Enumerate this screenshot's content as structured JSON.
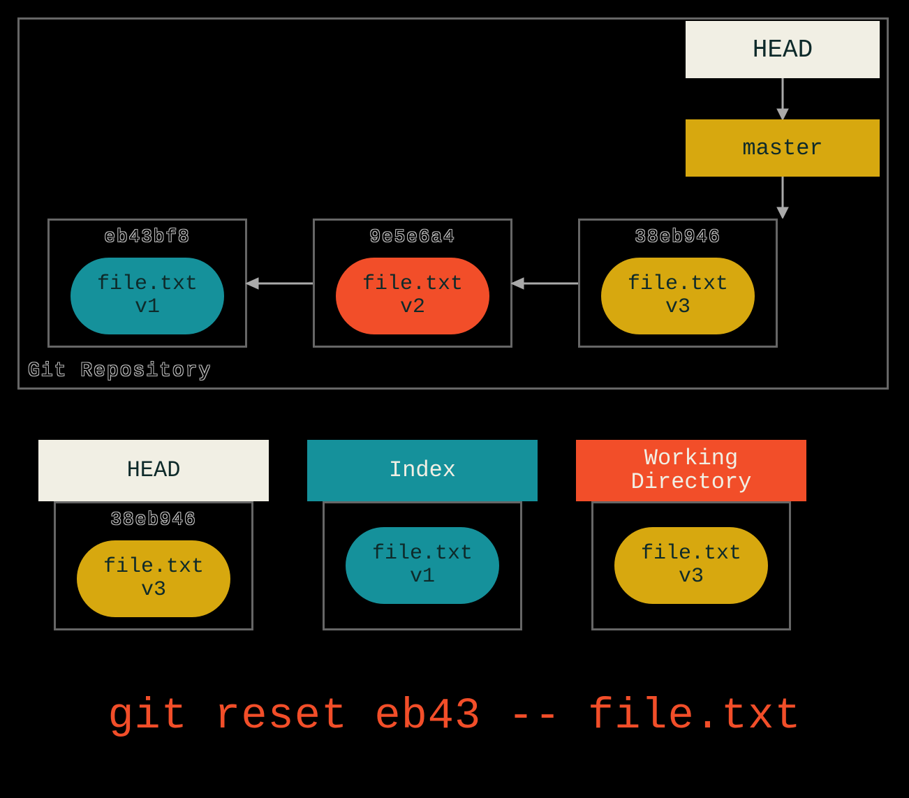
{
  "repo_label": "Git Repository",
  "head_top": "HEAD",
  "master": "master",
  "commits": [
    {
      "hash": "eb43bf8",
      "file": "file.txt",
      "ver": "v1",
      "color": "teal"
    },
    {
      "hash": "9e5e6a4",
      "file": "file.txt",
      "ver": "v2",
      "color": "orange"
    },
    {
      "hash": "38eb946",
      "file": "file.txt",
      "ver": "v3",
      "color": "gold"
    }
  ],
  "trees": {
    "head": {
      "label": "HEAD",
      "hash": "38eb946",
      "file": "file.txt",
      "ver": "v3",
      "pill_color": "gold"
    },
    "index": {
      "label": "Index",
      "file": "file.txt",
      "ver": "v1",
      "pill_color": "teal"
    },
    "work": {
      "label": "Working\nDirectory",
      "file": "file.txt",
      "ver": "v3",
      "pill_color": "gold"
    }
  },
  "command": "git reset eb43 -- file.txt"
}
